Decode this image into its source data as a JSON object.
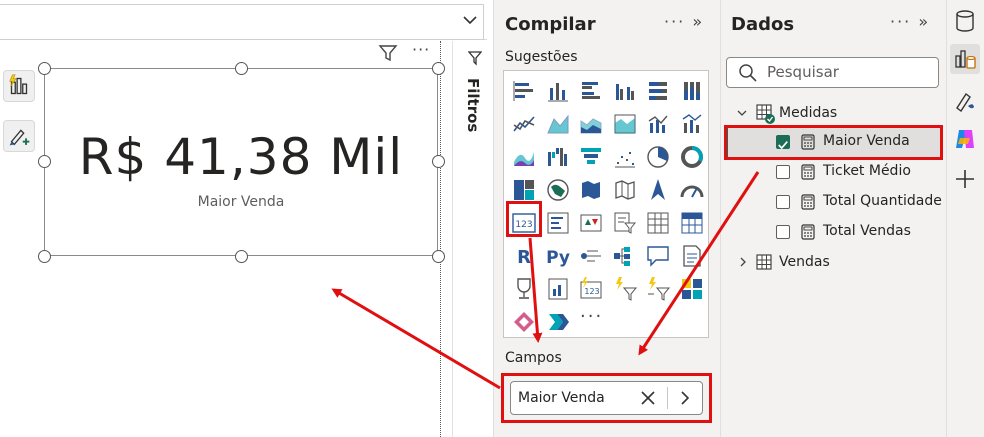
{
  "card": {
    "value": "R$ 41,38 Mil",
    "label": "Maior Venda"
  },
  "filters_pane": {
    "label": "Filtros"
  },
  "build_pane": {
    "title": "Compilar",
    "suggestions_label": "Sugestões",
    "fields_label": "Campos",
    "field_value": "Maior Venda",
    "more_visuals": "···"
  },
  "data_pane": {
    "title": "Dados",
    "search_placeholder": "Pesquisar",
    "tables": [
      {
        "name": "Medidas",
        "expanded": true,
        "items": [
          {
            "name": "Maior Venda",
            "checked": true
          },
          {
            "name": "Ticket Médio",
            "checked": false
          },
          {
            "name": "Total Quantidade",
            "checked": false
          },
          {
            "name": "Total Vendas",
            "checked": false
          }
        ]
      },
      {
        "name": "Vendas",
        "expanded": false
      }
    ]
  },
  "colors": {
    "accent_green": "#1b6e55",
    "annotation_red": "#e01010",
    "pane_bg": "#f3f2f1",
    "icon_blue": "#2b5797",
    "icon_teal": "#00a2b5"
  }
}
